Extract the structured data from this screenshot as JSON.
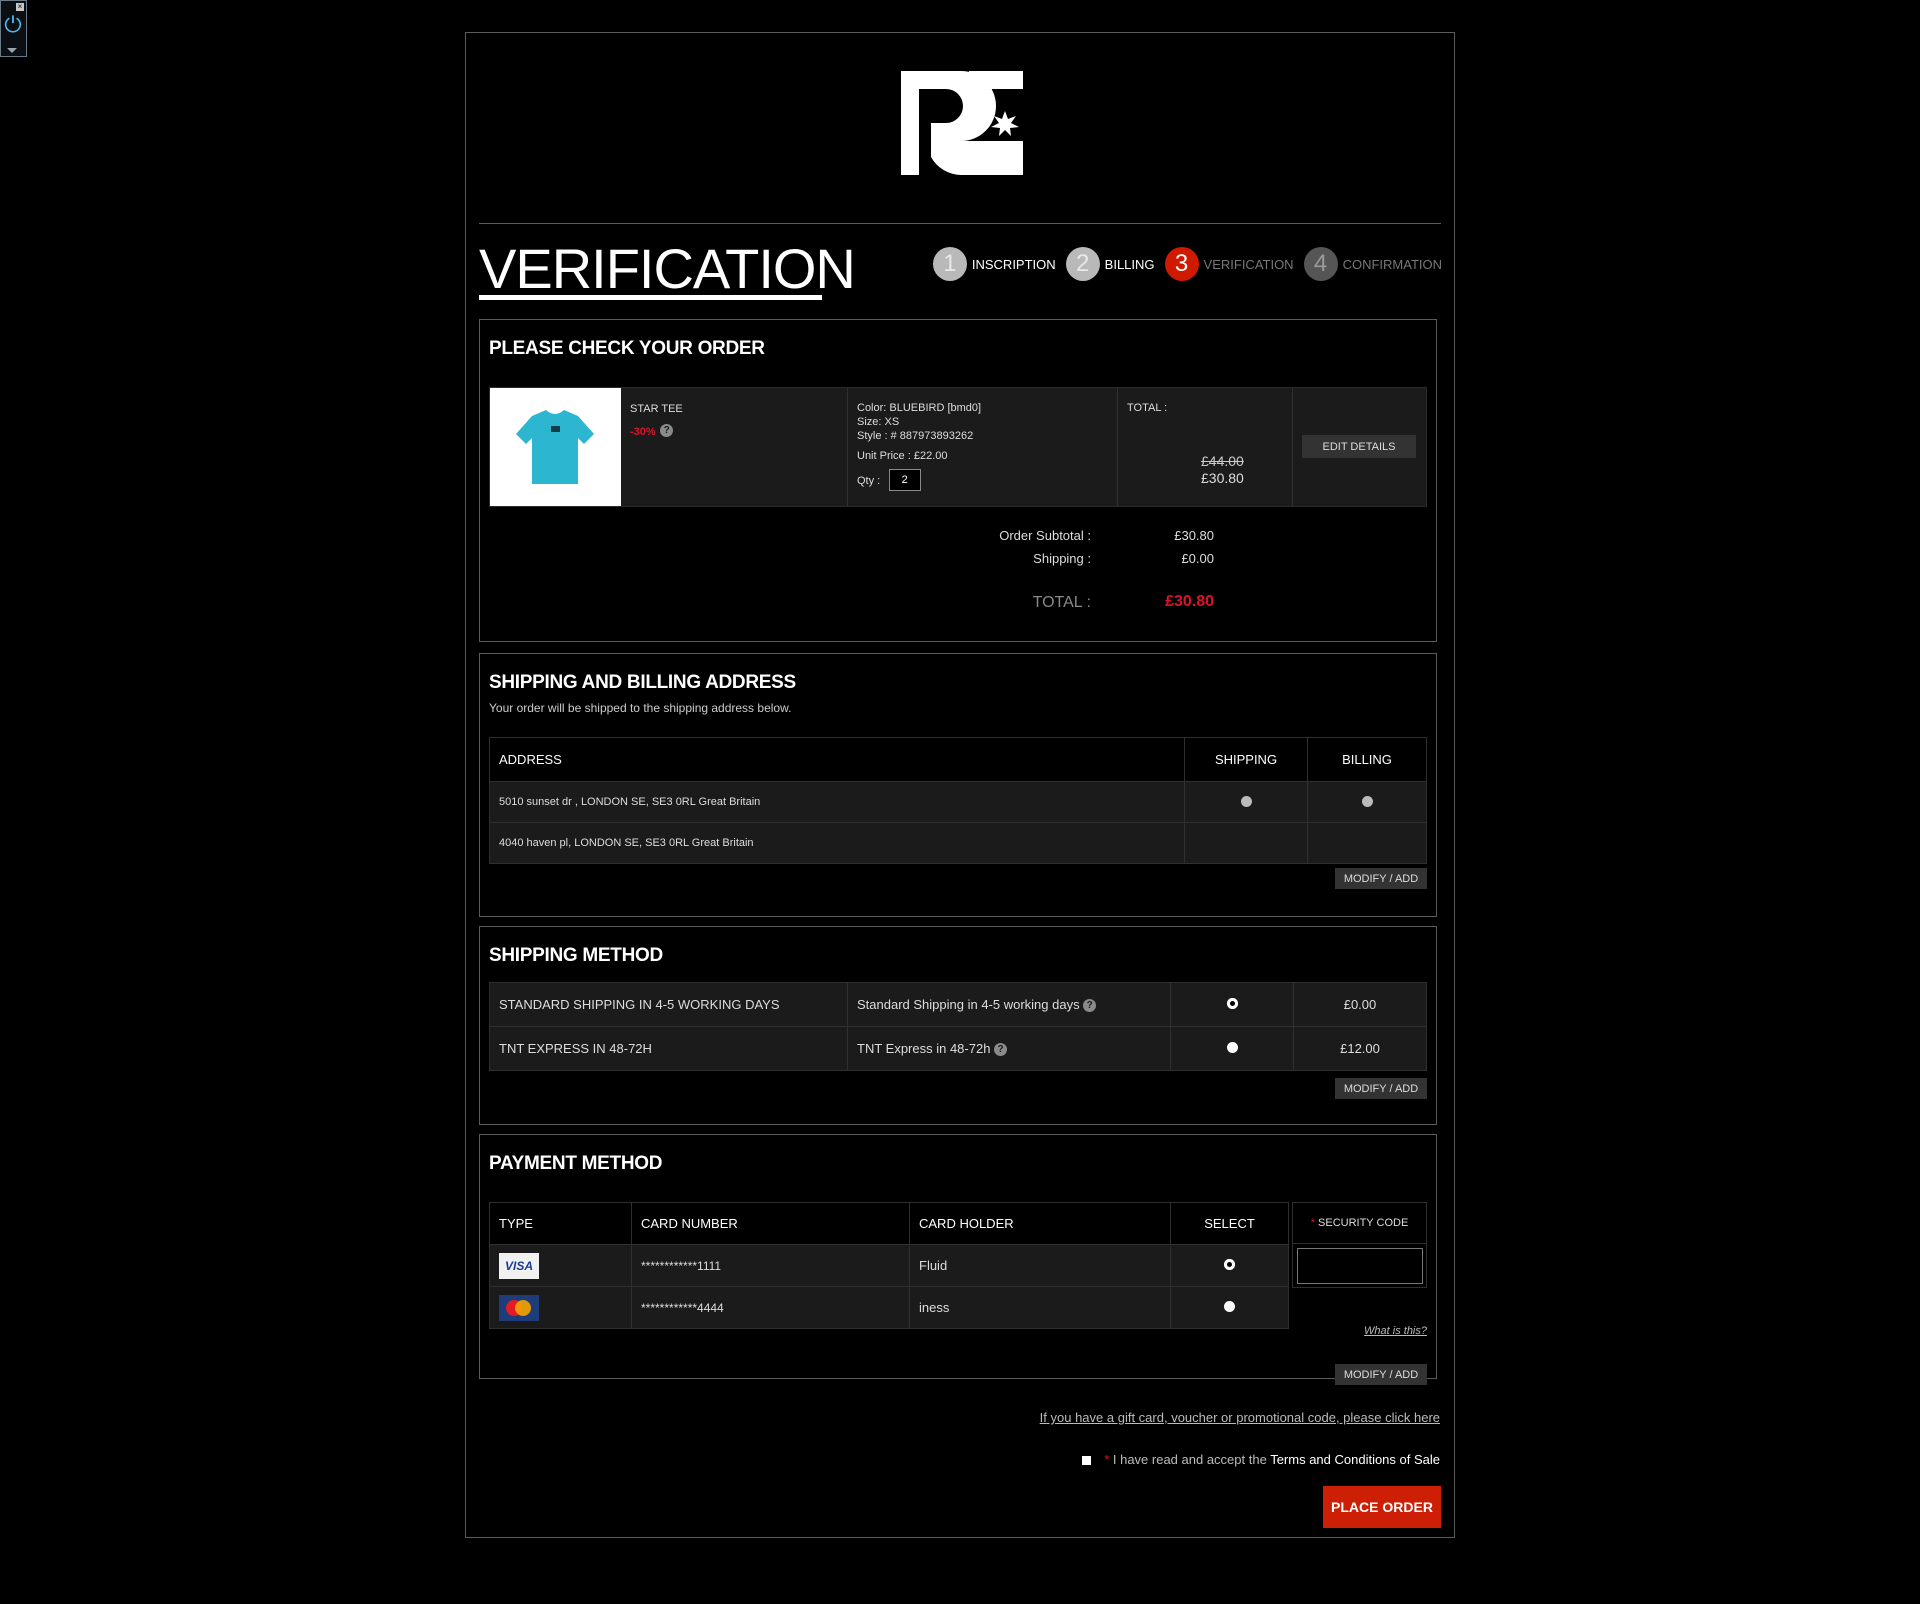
{
  "steps": [
    {
      "num": "1",
      "label": "INSCRIPTION"
    },
    {
      "num": "2",
      "label": "BILLING"
    },
    {
      "num": "3",
      "label": "VERIFICATION"
    },
    {
      "num": "4",
      "label": "CONFIRMATION"
    }
  ],
  "page_title": "VERIFICATION",
  "order": {
    "title": "PLEASE CHECK YOUR ORDER",
    "item": {
      "name": "STAR TEE",
      "discount": "-30%",
      "color": "Color: BLUEBIRD [bmd0]",
      "size": "Size: XS",
      "style": "Style : # 887973893262",
      "unit_price": "Unit Price : £22.00",
      "qty_label": "Qty :",
      "qty": "2",
      "total_label": "TOTAL :",
      "old_total": "£44.00",
      "new_total": "£30.80",
      "edit_label": "EDIT DETAILS"
    },
    "summary": {
      "subtotal_label": "Order Subtotal :",
      "subtotal_value": "£30.80",
      "shipping_label": "Shipping :",
      "shipping_value": "£0.00",
      "total_label": "TOTAL :",
      "total_value": "£30.80"
    }
  },
  "address": {
    "title": "SHIPPING AND BILLING ADDRESS",
    "subtitle": "Your order will be shipped to the shipping address below.",
    "headers": {
      "address": "ADDRESS",
      "shipping": "SHIPPING",
      "billing": "BILLING"
    },
    "rows": [
      "5010 sunset dr , LONDON SE, SE3 0RL Great Britain",
      "4040 haven pl, LONDON SE, SE3 0RL Great Britain"
    ],
    "modify_label": "MODIFY / ADD"
  },
  "shipping_method": {
    "title": "SHIPPING METHOD",
    "rows": [
      {
        "name": "STANDARD SHIPPING IN 4-5 WORKING DAYS",
        "desc": "Standard Shipping in 4-5 working days",
        "price": "£0.00"
      },
      {
        "name": "TNT EXPRESS IN 48-72H",
        "desc": "TNT Express in 48-72h",
        "price": "£12.00"
      }
    ],
    "modify_label": "MODIFY / ADD"
  },
  "payment": {
    "title": "PAYMENT METHOD",
    "headers": {
      "type": "TYPE",
      "number": "CARD NUMBER",
      "holder": "CARD HOLDER",
      "select": "SELECT"
    },
    "rows": [
      {
        "type_icon": "visa-card-icon",
        "visa_text": "VISA",
        "number": "************1111",
        "holder": "Fluid"
      },
      {
        "type_icon": "mastercard-card-icon",
        "number": "************4444",
        "holder": "iness"
      }
    ],
    "security_label": "SECURITY CODE",
    "required_mark": "*",
    "what_is_this": "What is this?",
    "modify_label": "MODIFY / ADD"
  },
  "footer": {
    "gift_link": "If you have a gift card, voucher or promotional code, please click here",
    "required_mark": "*",
    "terms_prefix": " I have read and accept the ",
    "terms_link": "Terms and Conditions of Sale",
    "place_order": "PLACE ORDER"
  },
  "colors": {
    "accent_red": "#cc1f06",
    "price_red": "#e0102a",
    "tee_blue": "#2cb6cf"
  }
}
